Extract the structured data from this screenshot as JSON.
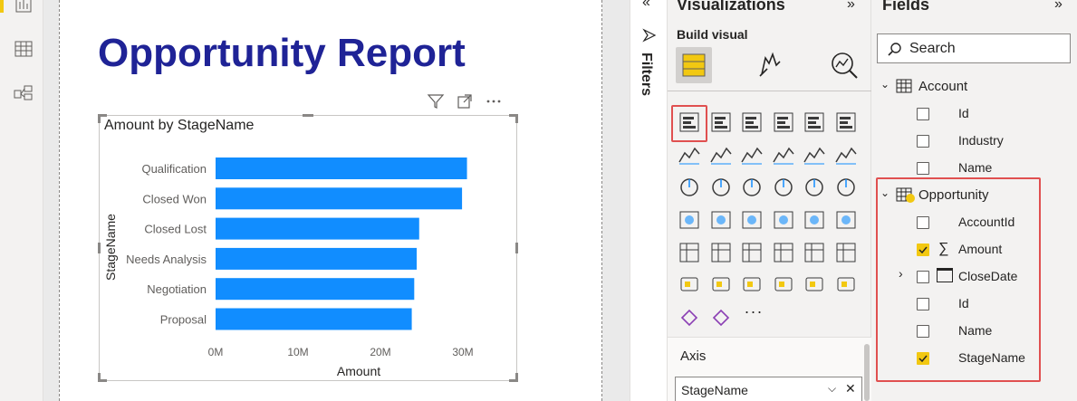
{
  "report": {
    "title": "Opportunity Report"
  },
  "chart_data": {
    "type": "bar",
    "orientation": "horizontal",
    "title": "Amount by StageName",
    "xlabel": "Amount",
    "ylabel": "StageName",
    "categories": [
      "Qualification",
      "Closed Won",
      "Closed Lost",
      "Needs Analysis",
      "Negotiation",
      "Proposal"
    ],
    "values": [
      30500000,
      29900000,
      24700000,
      24400000,
      24100000,
      23800000
    ],
    "xlim": [
      0,
      32000000
    ],
    "xticks": [
      "0M",
      "10M",
      "20M",
      "30M"
    ],
    "tick_values": [
      0,
      10000000,
      20000000,
      30000000
    ],
    "bar_color": "#118dff",
    "grid": false
  },
  "filters": {
    "label": "Filters"
  },
  "visualizations": {
    "title": "Visualizations",
    "build_visual_label": "Build visual",
    "more_label": "...",
    "axis_label": "Axis",
    "axis_field": "StageName"
  },
  "fields": {
    "title": "Fields",
    "search_placeholder": "Search",
    "tables": [
      {
        "name": "Account",
        "fields": [
          "Id",
          "Industry",
          "Name"
        ]
      },
      {
        "name": "Opportunity",
        "fields": [
          "AccountId",
          "Amount",
          "CloseDate",
          "Id",
          "Name",
          "StageName"
        ]
      }
    ]
  },
  "colors": {
    "accent": "#f2c811",
    "title_blue": "#1f2396",
    "bar_blue": "#118dff",
    "highlight_red": "#e05050"
  }
}
